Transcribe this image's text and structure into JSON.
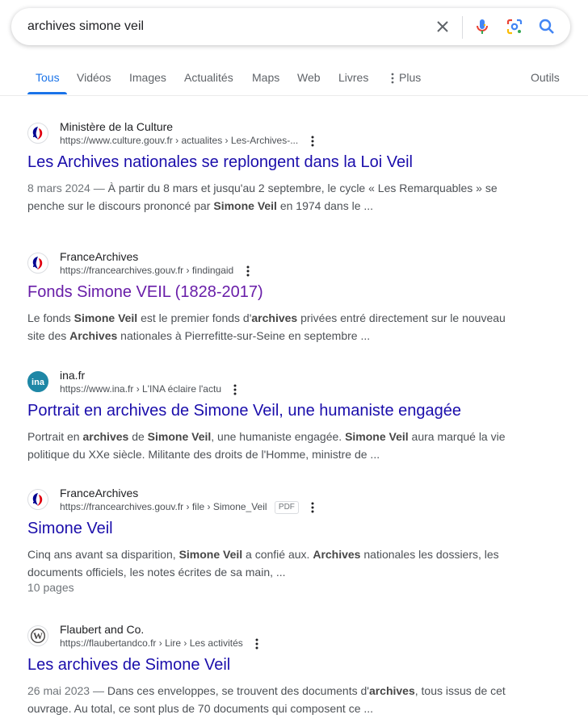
{
  "search": {
    "query": "archives simone veil"
  },
  "tabs": [
    "Tous",
    "Vidéos",
    "Images",
    "Actualités",
    "Maps",
    "Web",
    "Livres",
    "Plus",
    "Outils"
  ],
  "results": [
    {
      "site": "Ministère de la Culture",
      "url": "https://www.culture.gouv.fr › actualites › Les-Archives-...",
      "title": "Les Archives nationales se replongent dans la Loi Veil",
      "date": "8 mars 2024 —",
      "s1": " À partir du 8 mars et jusqu'au 2 septembre, le cycle « Les Remarquables » se penche sur le discours prononcé par ",
      "b1": "Simone Veil",
      "s2": " en 1974 dans le ..."
    },
    {
      "site": "FranceArchives",
      "url": "https://francearchives.gouv.fr › findingaid",
      "title": "Fonds Simone VEIL (1828-2017)",
      "s1": "Le fonds ",
      "b1": "Simone Veil",
      "s2": " est le premier fonds d'",
      "b2": "archives",
      "s3": " privées entré directement sur le nouveau site des ",
      "b3": "Archives",
      "s4": " nationales à Pierrefitte-sur-Seine en septembre ..."
    },
    {
      "site": "ina.fr",
      "url": "https://www.ina.fr › L'INA éclaire l'actu",
      "title": "Portrait en archives de Simone Veil, une humaniste engagée",
      "s1": "Portrait en ",
      "b1": "archives",
      "s2": " de ",
      "b2": "Simone Veil",
      "s3": ", une humaniste engagée. ",
      "b3": "Simone Veil",
      "s4": " aura marqué la vie politique du XXe siècle. Militante des droits de l'Homme, ministre de ..."
    },
    {
      "site": "FranceArchives",
      "url": "https://francearchives.gouv.fr › file › Simone_Veil",
      "badge": "PDF",
      "title": "Simone Veil",
      "s1": "Cinq ans avant sa disparition, ",
      "b1": "Simone Veil",
      "s2": " a confié aux. ",
      "b2": "Archives",
      "s3": " nationales les dossiers, les documents officiels, les notes écrites de sa main, ...",
      "pages": "10 pages"
    },
    {
      "site": "Flaubert and Co.",
      "url": "https://flaubertandco.fr › Lire › Les activités",
      "title": "Les archives de Simone Veil",
      "date": "26 mai 2023 —",
      "s1": " Dans ces enveloppes, se trouvent des documents d'",
      "b1": "archives",
      "s2": ", tous issus de cet ouvrage. Au total, ce sont plus de 70 documents qui composent ce ..."
    }
  ],
  "colors": {
    "link": "#1a0dab",
    "visited": "#681da8",
    "accent": "#1a73e8"
  },
  "icons": [
    "clear-icon",
    "microphone-icon",
    "lens-icon",
    "search-icon",
    "more-vert-icon",
    "marianne-logo-icon",
    "ina-logo-icon",
    "wordpress-logo-icon"
  ]
}
